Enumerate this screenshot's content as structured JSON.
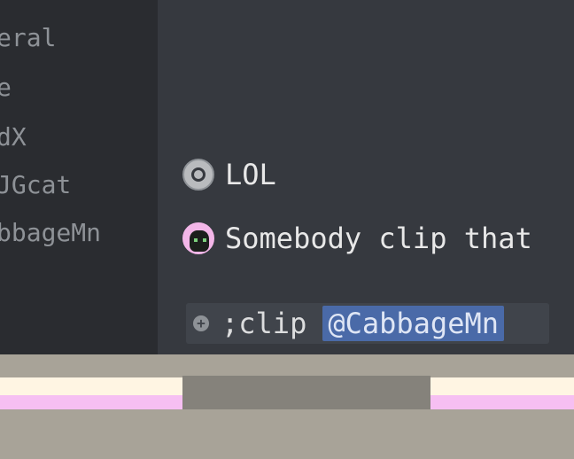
{
  "sidebar": {
    "items": [
      {
        "label": "eral"
      },
      {
        "label": "e"
      },
      {
        "label": "dX"
      },
      {
        "label": "JGcat"
      },
      {
        "label": "bbageMn"
      }
    ]
  },
  "chat": {
    "messages": [
      {
        "avatar_icon": "grey-circle-avatar-icon",
        "text": "LOL"
      },
      {
        "avatar_icon": "pink-cat-avatar-icon",
        "text": "Somebody clip that"
      }
    ]
  },
  "input": {
    "plus_icon": "+",
    "text": ";clip",
    "mention": "@CabbageMn"
  },
  "colors": {
    "mention_bg": "#4a6aa8",
    "hud_bg": "#a8a398",
    "hud_cream": "#fff5e3",
    "hud_pink": "#f6bff2"
  }
}
